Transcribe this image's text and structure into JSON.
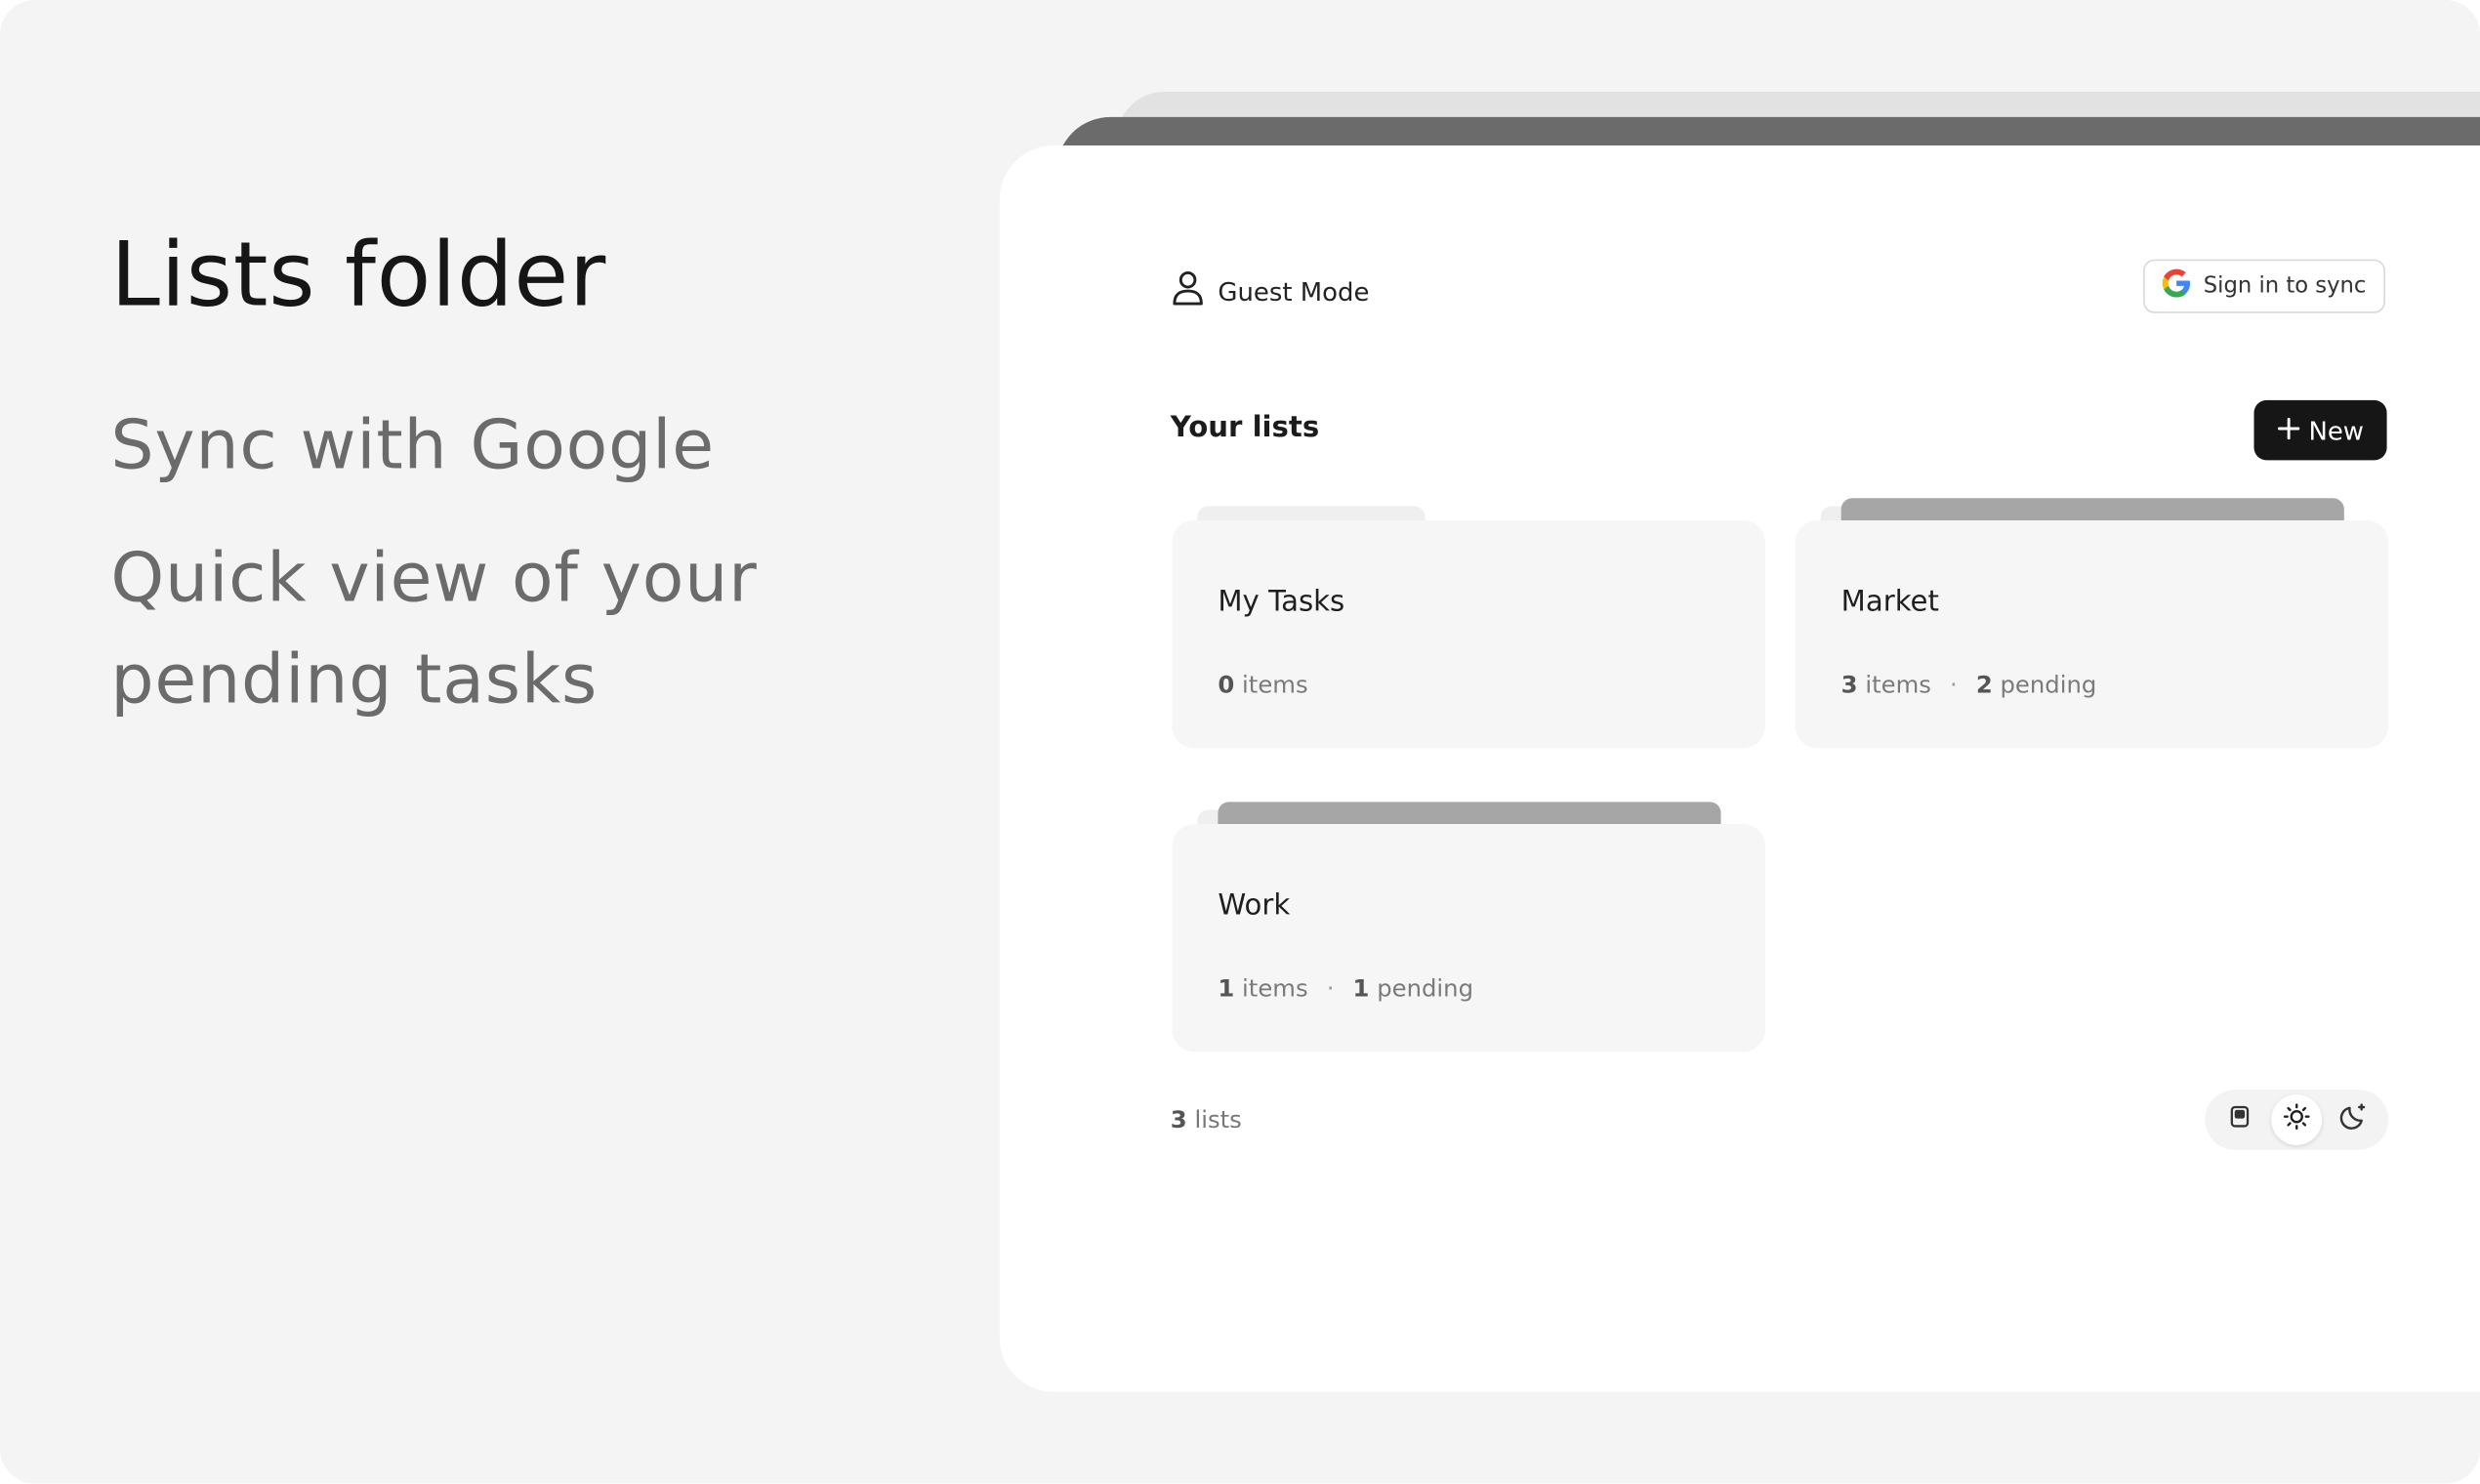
{
  "promo": {
    "title": "Lists folder",
    "features": [
      "Sync with Google",
      "Quick view of your pending tasks"
    ]
  },
  "header": {
    "mode_label": "Guest Mode",
    "mode_icon": "user-icon",
    "signin_label": "Sign in to sync",
    "signin_icon": "google-g-icon"
  },
  "lists_section": {
    "title": "Your lists",
    "new_label": "New",
    "new_icon": "plus-icon",
    "cards": [
      {
        "name": "My Tasks",
        "items": "0",
        "items_label": "items"
      },
      {
        "name": "Market",
        "items": "3",
        "items_label": "items",
        "pending": "2",
        "pending_label": "pending"
      },
      {
        "name": "Work",
        "items": "1",
        "items_label": "items",
        "pending": "1",
        "pending_label": "pending"
      }
    ]
  },
  "footer": {
    "count": "3",
    "count_label": "lists",
    "theme_options": [
      "system-icon",
      "sun-icon",
      "moon-icon"
    ],
    "theme_selected": "sun-icon"
  },
  "colors": {
    "background": "#f4f4f4",
    "window": "#ffffff",
    "card": "#f6f6f6",
    "accent": "#161616",
    "muted_text": "#6b6b6b"
  }
}
